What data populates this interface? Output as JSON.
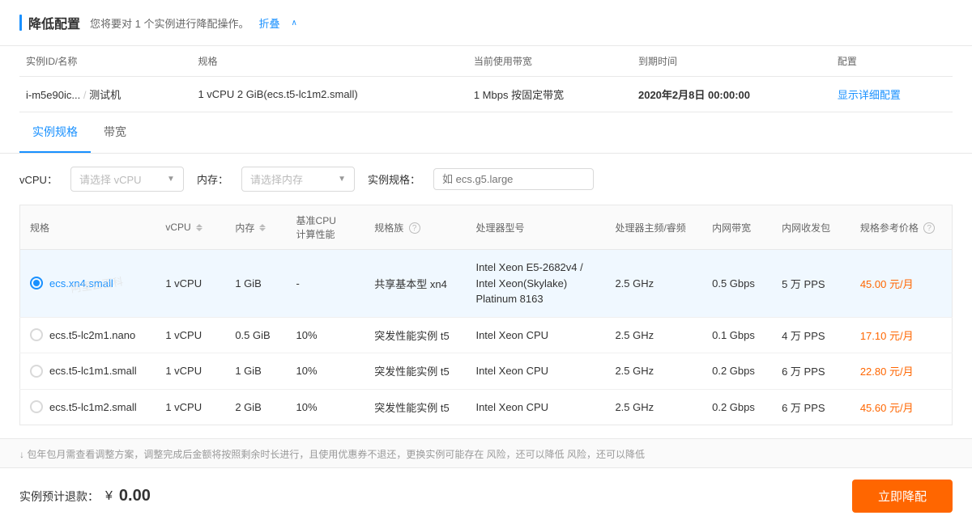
{
  "header": {
    "title": "降低配置",
    "subtitle": "您将要对 1 个实例进行降配操作。",
    "fold_label": "折叠",
    "chevron": "∧"
  },
  "instance_table": {
    "columns": [
      "实例ID/名称",
      "规格",
      "当前使用带宽",
      "到期时间",
      "配置"
    ],
    "row": {
      "id": "i-m5e90ic...",
      "name": "测试机",
      "spec": "1 vCPU 2 GiB(ecs.t5-lc1m2.small)",
      "bandwidth": "1 Mbps 按固定带宽",
      "expire": "2020年2月8日 00:00:00",
      "config_link": "显示详细配置"
    }
  },
  "tabs": [
    {
      "label": "实例规格",
      "active": true
    },
    {
      "label": "带宽",
      "active": false
    }
  ],
  "filter": {
    "vcpu_label": "vCPU：",
    "vcpu_placeholder": "请选择 vCPU",
    "memory_label": "内存：",
    "memory_placeholder": "请选择内存",
    "spec_label": "实例规格：",
    "spec_placeholder": "如 ecs.g5.large"
  },
  "spec_table": {
    "columns": [
      {
        "key": "spec",
        "label": "规格",
        "sortable": false
      },
      {
        "key": "vcpu",
        "label": "vCPU",
        "sortable": true
      },
      {
        "key": "memory",
        "label": "内存",
        "sortable": true
      },
      {
        "key": "cpu_perf",
        "label": "基准CPU\n计算性能",
        "sortable": false
      },
      {
        "key": "family",
        "label": "规格族",
        "sortable": false,
        "help": true
      },
      {
        "key": "cpu_model",
        "label": "处理器型号",
        "sortable": false
      },
      {
        "key": "cpu_freq",
        "label": "处理器主频/睿频",
        "sortable": false
      },
      {
        "key": "net_bw",
        "label": "内网带宽",
        "sortable": false
      },
      {
        "key": "net_pps",
        "label": "内网收发包",
        "sortable": false
      },
      {
        "key": "price",
        "label": "规格参考价格",
        "sortable": false,
        "help": true
      }
    ],
    "rows": [
      {
        "selected": true,
        "spec": "ecs.xn4.small",
        "vcpu": "1 vCPU",
        "memory": "1 GiB",
        "cpu_perf": "-",
        "family": "共享基本型 xn4",
        "cpu_model": "Intel Xeon E5-2682v4 / Intel Xeon(Skylake) Platinum 8163",
        "cpu_freq": "2.5 GHz",
        "net_bw": "0.5 Gbps",
        "net_pps": "5 万 PPS",
        "price": "45.00 元/月"
      },
      {
        "selected": false,
        "spec": "ecs.t5-lc2m1.nano",
        "vcpu": "1 vCPU",
        "memory": "0.5 GiB",
        "cpu_perf": "10%",
        "family": "突发性能实例 t5",
        "cpu_model": "Intel Xeon CPU",
        "cpu_freq": "2.5 GHz",
        "net_bw": "0.1 Gbps",
        "net_pps": "4 万 PPS",
        "price": "17.10 元/月"
      },
      {
        "selected": false,
        "spec": "ecs.t5-lc1m1.small",
        "vcpu": "1 vCPU",
        "memory": "1 GiB",
        "cpu_perf": "10%",
        "family": "突发性能实例 t5",
        "cpu_model": "Intel Xeon CPU",
        "cpu_freq": "2.5 GHz",
        "net_bw": "0.2 Gbps",
        "net_pps": "6 万 PPS",
        "price": "22.80 元/月"
      },
      {
        "selected": false,
        "spec": "ecs.t5-lc1m2.small",
        "vcpu": "1 vCPU",
        "memory": "2 GiB",
        "cpu_perf": "10%",
        "family": "突发性能实例 t5",
        "cpu_model": "Intel Xeon CPU",
        "cpu_freq": "2.5 GHz",
        "net_bw": "0.2 Gbps",
        "net_pps": "6 万 PPS",
        "price": "45.60 元/月"
      }
    ]
  },
  "footer_note": "↓ 包年包月需查看调整方案，调整完成后金额将按照剩余时长进行，且使用优惠券不退还，更换实例可能存在 风险，还可以降低 风险，还可以降低",
  "bottom_bar": {
    "refund_label": "实例预计退款：",
    "currency_symbol": "¥",
    "amount": "0.00",
    "submit_label": "立即降配"
  }
}
